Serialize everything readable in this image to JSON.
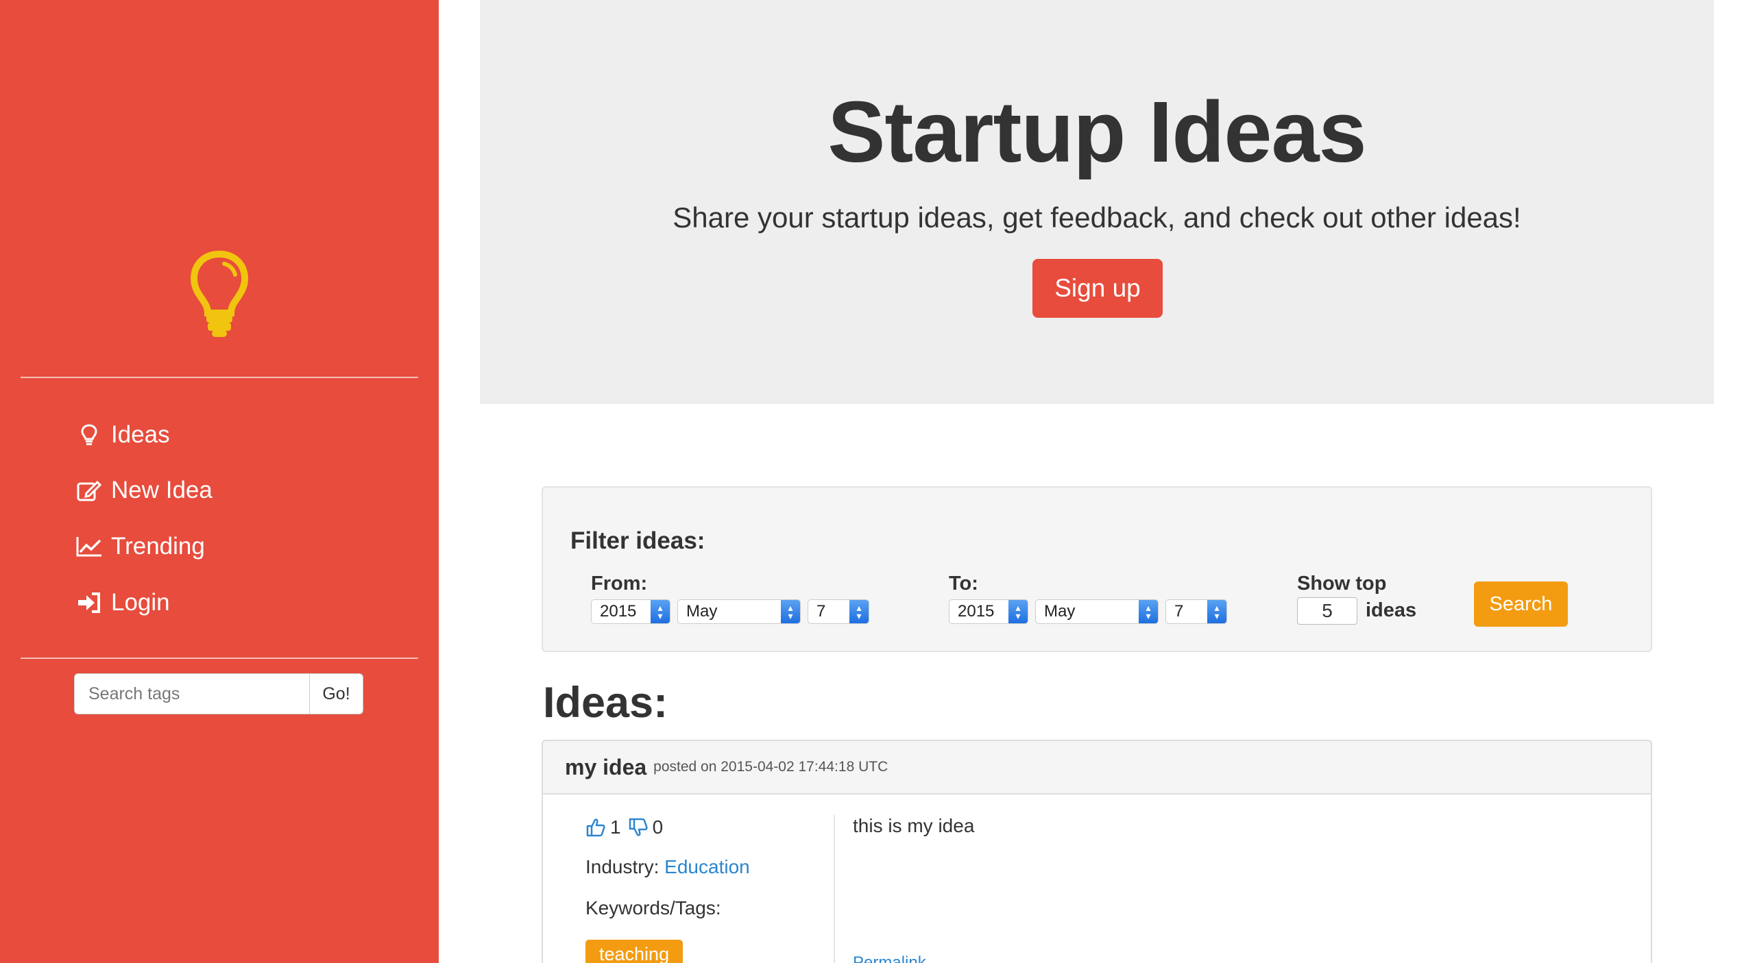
{
  "sidebar": {
    "logo_icon": "lightbulb-icon",
    "items": [
      {
        "label": "Ideas",
        "icon": "lightbulb-outline-icon"
      },
      {
        "label": "New Idea",
        "icon": "edit-icon"
      },
      {
        "label": "Trending",
        "icon": "line-chart-icon"
      },
      {
        "label": "Login",
        "icon": "sign-in-icon"
      }
    ],
    "search": {
      "placeholder": "Search tags",
      "button": "Go!"
    }
  },
  "jumbotron": {
    "title": "Startup Ideas",
    "lead": "Share your startup ideas, get feedback, and check out other ideas!",
    "signup": "Sign up"
  },
  "filter": {
    "title": "Filter ideas:",
    "from": {
      "label": "From:",
      "year": "2015",
      "month": "May",
      "day": "7"
    },
    "to": {
      "label": "To:",
      "year": "2015",
      "month": "May",
      "day": "7"
    },
    "show_top_label": "Show top",
    "top_count": "5",
    "ideas_word": "ideas",
    "search_button": "Search"
  },
  "ideas_heading": "Ideas:",
  "ideas": [
    {
      "title": "my idea",
      "meta": "posted on 2015-04-02 17:44:18 UTC",
      "upvotes": "1",
      "downvotes": "0",
      "industry_label": "Industry:",
      "industry": "Education",
      "keywords_label": "Keywords/Tags:",
      "tag": "teaching",
      "body": "this is my idea",
      "permalink": "Permalink"
    }
  ],
  "colors": {
    "sidebar": "#e74c3c",
    "accent_orange": "#f39c12",
    "logo": "#f1c40f",
    "link": "#2a86d0"
  }
}
